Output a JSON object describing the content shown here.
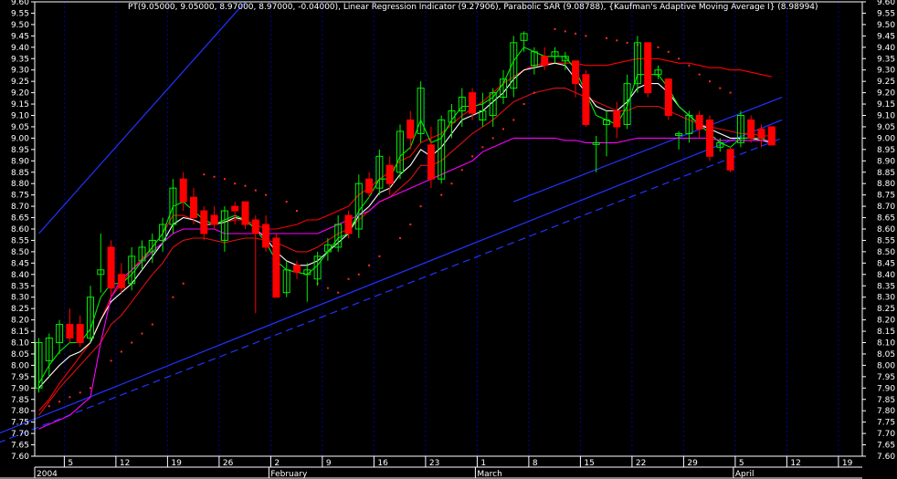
{
  "chart_data": {
    "type": "candlestick",
    "symbol": "PT",
    "header": "PT(9.05000, 9.05000, 8.97000, 8.97000, -0.04000), Linear Regression Indicator (9.27906), Parabolic SAR (9.08788), {Kaufman's Adaptive Moving Average I} (8.98994)",
    "ylim": [
      7.6,
      9.6
    ],
    "yticks": [
      "7.60",
      "7.65",
      "7.70",
      "7.75",
      "7.80",
      "7.85",
      "7.90",
      "7.95",
      "8.00",
      "8.05",
      "8.10",
      "8.15",
      "8.20",
      "8.25",
      "8.30",
      "8.35",
      "8.40",
      "8.45",
      "8.50",
      "8.55",
      "8.60",
      "8.65",
      "8.70",
      "8.75",
      "8.80",
      "8.85",
      "8.90",
      "8.95",
      "9.00",
      "9.05",
      "9.10",
      "9.15",
      "9.20",
      "9.25",
      "9.30",
      "9.35",
      "9.40",
      "9.45",
      "9.50",
      "9.55",
      "9.60"
    ],
    "xticks": [
      {
        "label": "5",
        "index": 3
      },
      {
        "label": "12",
        "index": 8
      },
      {
        "label": "19",
        "index": 13
      },
      {
        "label": "26",
        "index": 18
      },
      {
        "label": "2",
        "index": 23
      },
      {
        "label": "9",
        "index": 28
      },
      {
        "label": "16",
        "index": 33
      },
      {
        "label": "23",
        "index": 38
      },
      {
        "label": "1",
        "index": 43
      },
      {
        "label": "8",
        "index": 48
      },
      {
        "label": "15",
        "index": 53
      },
      {
        "label": "22",
        "index": 58
      },
      {
        "label": "29",
        "index": 63
      },
      {
        "label": "5",
        "index": 68
      },
      {
        "label": "12",
        "index": 73
      },
      {
        "label": "19",
        "index": 78
      }
    ],
    "months": [
      {
        "label": "2004",
        "index": 0
      },
      {
        "label": "February",
        "index": 23
      },
      {
        "label": "March",
        "index": 43
      },
      {
        "label": "April",
        "index": 68
      }
    ],
    "candles": [
      {
        "o": 7.9,
        "h": 8.12,
        "l": 7.88,
        "c": 8.1
      },
      {
        "o": 8.02,
        "h": 8.14,
        "l": 7.95,
        "c": 8.12
      },
      {
        "o": 8.1,
        "h": 8.2,
        "l": 8.05,
        "c": 8.18
      },
      {
        "o": 8.18,
        "h": 8.25,
        "l": 8.1,
        "c": 8.12
      },
      {
        "o": 8.18,
        "h": 8.22,
        "l": 8.08,
        "c": 8.1
      },
      {
        "o": 8.12,
        "h": 8.35,
        "l": 8.1,
        "c": 8.3
      },
      {
        "o": 8.4,
        "h": 8.58,
        "l": 8.32,
        "c": 8.42
      },
      {
        "o": 8.52,
        "h": 8.55,
        "l": 8.3,
        "c": 8.34
      },
      {
        "o": 8.4,
        "h": 8.45,
        "l": 8.32,
        "c": 8.34
      },
      {
        "o": 8.36,
        "h": 8.52,
        "l": 8.33,
        "c": 8.48
      },
      {
        "o": 8.46,
        "h": 8.55,
        "l": 8.42,
        "c": 8.52
      },
      {
        "o": 8.5,
        "h": 8.58,
        "l": 8.45,
        "c": 8.55
      },
      {
        "o": 8.55,
        "h": 8.65,
        "l": 8.5,
        "c": 8.62
      },
      {
        "o": 8.62,
        "h": 8.82,
        "l": 8.58,
        "c": 8.78
      },
      {
        "o": 8.82,
        "h": 8.85,
        "l": 8.68,
        "c": 8.72
      },
      {
        "o": 8.74,
        "h": 8.78,
        "l": 8.62,
        "c": 8.65
      },
      {
        "o": 8.68,
        "h": 8.7,
        "l": 8.55,
        "c": 8.58
      },
      {
        "o": 8.66,
        "h": 8.7,
        "l": 8.6,
        "c": 8.62
      },
      {
        "o": 8.55,
        "h": 8.7,
        "l": 8.5,
        "c": 8.68
      },
      {
        "o": 8.7,
        "h": 8.72,
        "l": 8.62,
        "c": 8.68
      },
      {
        "o": 8.72,
        "h": 8.72,
        "l": 8.6,
        "c": 8.62
      },
      {
        "o": 8.64,
        "h": 8.66,
        "l": 8.23,
        "c": 8.58
      },
      {
        "o": 8.62,
        "h": 8.66,
        "l": 8.5,
        "c": 8.52
      },
      {
        "o": 8.56,
        "h": 8.58,
        "l": 8.3,
        "c": 8.3
      },
      {
        "o": 8.32,
        "h": 8.46,
        "l": 8.3,
        "c": 8.42
      },
      {
        "o": 8.44,
        "h": 8.46,
        "l": 8.38,
        "c": 8.41
      },
      {
        "o": 8.4,
        "h": 8.45,
        "l": 8.28,
        "c": 8.42
      },
      {
        "o": 8.38,
        "h": 8.5,
        "l": 8.35,
        "c": 8.48
      },
      {
        "o": 8.5,
        "h": 8.56,
        "l": 8.46,
        "c": 8.53
      },
      {
        "o": 8.52,
        "h": 8.66,
        "l": 8.5,
        "c": 8.62
      },
      {
        "o": 8.66,
        "h": 8.68,
        "l": 8.56,
        "c": 8.58
      },
      {
        "o": 8.6,
        "h": 8.84,
        "l": 8.56,
        "c": 8.8
      },
      {
        "o": 8.82,
        "h": 8.85,
        "l": 8.74,
        "c": 8.76
      },
      {
        "o": 8.78,
        "h": 8.95,
        "l": 8.75,
        "c": 8.92
      },
      {
        "o": 8.88,
        "h": 8.92,
        "l": 8.75,
        "c": 8.8
      },
      {
        "o": 8.85,
        "h": 9.06,
        "l": 8.82,
        "c": 9.03
      },
      {
        "o": 9.08,
        "h": 9.12,
        "l": 8.95,
        "c": 9.0
      },
      {
        "o": 9.02,
        "h": 9.25,
        "l": 8.98,
        "c": 9.22
      },
      {
        "o": 8.97,
        "h": 9.05,
        "l": 8.78,
        "c": 8.82
      },
      {
        "o": 8.82,
        "h": 9.1,
        "l": 8.8,
        "c": 9.08
      },
      {
        "o": 9.07,
        "h": 9.15,
        "l": 9.0,
        "c": 9.12
      },
      {
        "o": 9.12,
        "h": 9.22,
        "l": 9.05,
        "c": 9.18
      },
      {
        "o": 9.2,
        "h": 9.22,
        "l": 9.08,
        "c": 9.11
      },
      {
        "o": 9.08,
        "h": 9.2,
        "l": 9.05,
        "c": 9.12
      },
      {
        "o": 9.1,
        "h": 9.22,
        "l": 9.05,
        "c": 9.2
      },
      {
        "o": 9.18,
        "h": 9.3,
        "l": 9.15,
        "c": 9.26
      },
      {
        "o": 9.22,
        "h": 9.45,
        "l": 9.18,
        "c": 9.42
      },
      {
        "o": 9.43,
        "h": 9.47,
        "l": 9.38,
        "c": 9.46
      },
      {
        "o": 9.32,
        "h": 9.4,
        "l": 9.28,
        "c": 9.38
      },
      {
        "o": 9.36,
        "h": 9.4,
        "l": 9.3,
        "c": 9.32
      },
      {
        "o": 9.36,
        "h": 9.4,
        "l": 9.33,
        "c": 9.38
      },
      {
        "o": 9.34,
        "h": 9.38,
        "l": 9.3,
        "c": 9.36
      },
      {
        "o": 9.34,
        "h": 9.34,
        "l": 9.18,
        "c": 9.24
      },
      {
        "o": 9.28,
        "h": 9.3,
        "l": 9.05,
        "c": 9.06
      },
      {
        "o": 8.98,
        "h": 9.01,
        "l": 8.85,
        "c": 8.98
      },
      {
        "o": 9.06,
        "h": 9.12,
        "l": 8.92,
        "c": 9.08
      },
      {
        "o": 9.12,
        "h": 9.16,
        "l": 9.0,
        "c": 9.05
      },
      {
        "o": 9.06,
        "h": 9.28,
        "l": 9.04,
        "c": 9.24
      },
      {
        "o": 9.24,
        "h": 9.45,
        "l": 9.2,
        "c": 9.42
      },
      {
        "o": 9.42,
        "h": 9.42,
        "l": 9.18,
        "c": 9.2
      },
      {
        "o": 9.28,
        "h": 9.32,
        "l": 9.26,
        "c": 9.3
      },
      {
        "o": 9.26,
        "h": 9.26,
        "l": 9.08,
        "c": 9.1
      },
      {
        "o": 9.02,
        "h": 9.03,
        "l": 8.95,
        "c": 9.02
      },
      {
        "o": 9.02,
        "h": 9.12,
        "l": 8.98,
        "c": 9.1
      },
      {
        "o": 9.1,
        "h": 9.12,
        "l": 9.0,
        "c": 9.04
      },
      {
        "o": 9.08,
        "h": 9.1,
        "l": 8.9,
        "c": 8.92
      },
      {
        "o": 8.96,
        "h": 9.0,
        "l": 8.94,
        "c": 8.98
      },
      {
        "o": 8.95,
        "h": 8.96,
        "l": 8.85,
        "c": 8.86
      },
      {
        "o": 8.98,
        "h": 9.12,
        "l": 8.96,
        "c": 9.1
      },
      {
        "o": 9.08,
        "h": 9.1,
        "l": 8.98,
        "c": 9.0
      },
      {
        "o": 9.04,
        "h": 9.06,
        "l": 8.96,
        "c": 9.0
      },
      {
        "o": 9.05,
        "h": 9.05,
        "l": 8.97,
        "c": 8.97
      }
    ],
    "series": [
      {
        "kind": "line",
        "color": "#ff0000",
        "values": [
          7.8,
          7.85,
          7.92,
          7.98,
          8.04,
          8.1,
          8.2,
          8.3,
          8.36,
          8.42,
          8.47,
          8.52,
          8.58,
          8.66,
          8.66,
          8.64,
          8.62,
          8.62,
          8.63,
          8.64,
          8.64,
          8.62,
          8.6,
          8.6,
          8.61,
          8.62,
          8.64,
          8.64,
          8.66,
          8.68,
          8.7,
          8.75,
          8.78,
          8.82,
          8.85,
          8.9,
          8.92,
          8.98,
          9.0,
          9.02,
          9.06,
          9.1,
          9.13,
          9.16,
          9.2,
          9.24,
          9.27,
          9.3,
          9.32,
          9.33,
          9.33,
          9.33,
          9.33,
          9.32,
          9.32,
          9.32,
          9.33,
          9.34,
          9.35,
          9.35,
          9.35,
          9.34,
          9.33,
          9.33,
          9.32,
          9.31,
          9.31,
          9.3,
          9.3,
          9.29,
          9.28,
          9.27
        ]
      },
      {
        "kind": "line",
        "color": "#dd1111",
        "values": [
          7.78,
          7.84,
          7.9,
          7.95,
          8.0,
          8.05,
          8.1,
          8.18,
          8.22,
          8.28,
          8.34,
          8.4,
          8.45,
          8.52,
          8.55,
          8.56,
          8.56,
          8.55,
          8.54,
          8.55,
          8.56,
          8.56,
          8.55,
          8.54,
          8.52,
          8.5,
          8.5,
          8.52,
          8.55,
          8.58,
          8.6,
          8.64,
          8.68,
          8.72,
          8.74,
          8.78,
          8.82,
          8.88,
          8.88,
          8.9,
          8.94,
          8.98,
          9.02,
          9.05,
          9.08,
          9.12,
          9.16,
          9.18,
          9.2,
          9.21,
          9.22,
          9.22,
          9.2,
          9.18,
          9.16,
          9.14,
          9.12,
          9.12,
          9.14,
          9.14,
          9.14,
          9.12,
          9.1,
          9.08,
          9.06,
          9.05,
          9.04,
          9.03,
          9.02,
          9.02,
          9.01,
          9.01
        ]
      },
      {
        "kind": "line",
        "color": "#ffffff",
        "values": [
          7.9,
          7.95,
          8.0,
          8.04,
          8.06,
          8.1,
          8.2,
          8.28,
          8.32,
          8.36,
          8.42,
          8.48,
          8.54,
          8.62,
          8.65,
          8.64,
          8.62,
          8.62,
          8.63,
          8.65,
          8.64,
          8.6,
          8.56,
          8.5,
          8.46,
          8.44,
          8.44,
          8.46,
          8.5,
          8.54,
          8.58,
          8.66,
          8.7,
          8.76,
          8.78,
          8.84,
          8.88,
          8.95,
          8.92,
          8.96,
          9.02,
          9.08,
          9.1,
          9.12,
          9.16,
          9.2,
          9.26,
          9.3,
          9.31,
          9.32,
          9.33,
          9.32,
          9.26,
          9.2,
          9.14,
          9.12,
          9.12,
          9.16,
          9.22,
          9.24,
          9.24,
          9.2,
          9.14,
          9.1,
          9.06,
          9.04,
          9.02,
          9.0,
          9.0,
          9.0,
          8.99,
          8.98
        ]
      },
      {
        "kind": "line",
        "color": "#00ee00",
        "values": [
          7.92,
          8.0,
          8.06,
          8.1,
          8.1,
          8.16,
          8.3,
          8.36,
          8.36,
          8.4,
          8.46,
          8.52,
          8.58,
          8.7,
          8.72,
          8.68,
          8.64,
          8.62,
          8.64,
          8.66,
          8.64,
          8.6,
          8.54,
          8.46,
          8.42,
          8.41,
          8.4,
          8.44,
          8.5,
          8.56,
          8.58,
          8.68,
          8.74,
          8.82,
          8.82,
          8.92,
          8.96,
          9.08,
          8.98,
          9.0,
          9.08,
          9.14,
          9.14,
          9.15,
          9.18,
          9.24,
          9.34,
          9.4,
          9.38,
          9.36,
          9.36,
          9.36,
          9.3,
          9.2,
          9.1,
          9.08,
          9.06,
          9.14,
          9.28,
          9.28,
          9.28,
          9.22,
          9.14,
          9.1,
          9.06,
          9.02,
          8.98,
          8.96,
          9.0,
          9.0,
          9.0,
          8.98
        ]
      },
      {
        "kind": "line",
        "color": "#ff00ff",
        "values": [
          7.72,
          7.74,
          7.76,
          7.78,
          7.82,
          7.86,
          8.1,
          8.3,
          8.38,
          8.42,
          8.46,
          8.5,
          8.54,
          8.58,
          8.6,
          8.6,
          8.6,
          8.6,
          8.58,
          8.58,
          8.58,
          8.58,
          8.58,
          8.58,
          8.58,
          8.58,
          8.58,
          8.58,
          8.6,
          8.62,
          8.64,
          8.66,
          8.68,
          8.72,
          8.74,
          8.76,
          8.78,
          8.8,
          8.82,
          8.84,
          8.86,
          8.88,
          8.9,
          8.94,
          8.96,
          8.98,
          9.0,
          9.0,
          9.0,
          9.0,
          9.0,
          8.99,
          8.99,
          8.98,
          8.98,
          8.98,
          8.98,
          8.99,
          9.0,
          9.0,
          9.0,
          9.0,
          9.0,
          9.0,
          9.0,
          9.0,
          8.99,
          8.99,
          8.99,
          8.99,
          8.99,
          8.99
        ]
      }
    ],
    "sar": [
      {
        "i": 1,
        "v": 7.82
      },
      {
        "i": 2,
        "v": 7.84
      },
      {
        "i": 3,
        "v": 7.86
      },
      {
        "i": 4,
        "v": 7.88
      },
      {
        "i": 5,
        "v": 7.9
      },
      {
        "i": 7,
        "v": 8.02
      },
      {
        "i": 8,
        "v": 8.06
      },
      {
        "i": 9,
        "v": 8.1
      },
      {
        "i": 10,
        "v": 8.14
      },
      {
        "i": 11,
        "v": 8.18
      },
      {
        "i": 13,
        "v": 8.3
      },
      {
        "i": 14,
        "v": 8.36
      },
      {
        "i": 16,
        "v": 8.84
      },
      {
        "i": 17,
        "v": 8.83
      },
      {
        "i": 18,
        "v": 8.82
      },
      {
        "i": 19,
        "v": 8.8
      },
      {
        "i": 20,
        "v": 8.79
      },
      {
        "i": 21,
        "v": 8.77
      },
      {
        "i": 22,
        "v": 8.75
      },
      {
        "i": 24,
        "v": 8.72
      },
      {
        "i": 25,
        "v": 8.68
      },
      {
        "i": 26,
        "v": 8.4
      },
      {
        "i": 27,
        "v": 8.36
      },
      {
        "i": 28,
        "v": 8.34
      },
      {
        "i": 29,
        "v": 8.32
      },
      {
        "i": 30,
        "v": 8.38
      },
      {
        "i": 31,
        "v": 8.4
      },
      {
        "i": 32,
        "v": 8.44
      },
      {
        "i": 33,
        "v": 8.48
      },
      {
        "i": 35,
        "v": 8.56
      },
      {
        "i": 36,
        "v": 8.62
      },
      {
        "i": 37,
        "v": 8.7
      },
      {
        "i": 39,
        "v": 8.75
      },
      {
        "i": 40,
        "v": 8.8
      },
      {
        "i": 41,
        "v": 8.86
      },
      {
        "i": 42,
        "v": 8.92
      },
      {
        "i": 43,
        "v": 8.96
      },
      {
        "i": 44,
        "v": 9.0
      },
      {
        "i": 45,
        "v": 9.04
      },
      {
        "i": 46,
        "v": 9.08
      },
      {
        "i": 47,
        "v": 9.15
      },
      {
        "i": 48,
        "v": 9.2
      },
      {
        "i": 50,
        "v": 9.48
      },
      {
        "i": 51,
        "v": 9.47
      },
      {
        "i": 52,
        "v": 9.46
      },
      {
        "i": 53,
        "v": 9.45
      },
      {
        "i": 55,
        "v": 9.44
      },
      {
        "i": 56,
        "v": 9.43
      },
      {
        "i": 57,
        "v": 9.42
      },
      {
        "i": 58,
        "v": 9.41
      },
      {
        "i": 60,
        "v": 9.4
      },
      {
        "i": 61,
        "v": 9.38
      },
      {
        "i": 62,
        "v": 9.35
      },
      {
        "i": 63,
        "v": 9.32
      },
      {
        "i": 64,
        "v": 9.28
      },
      {
        "i": 65,
        "v": 9.25
      },
      {
        "i": 66,
        "v": 9.22
      },
      {
        "i": 67,
        "v": 9.2
      }
    ],
    "channels": [
      {
        "color": "#2233ff",
        "dash": false,
        "from": [
          0,
          8.58
        ],
        "to": [
          20,
          9.6
        ]
      },
      {
        "color": "#2233ff",
        "dash": false,
        "from": [
          -5,
          7.68
        ],
        "to": [
          72,
          9.08
        ]
      },
      {
        "color": "#2233ff",
        "dash": false,
        "from": [
          46,
          8.72
        ],
        "to": [
          72,
          9.18
        ]
      },
      {
        "color": "#2233ff",
        "dash": true,
        "from": [
          -5,
          7.64
        ],
        "to": [
          72,
          9.0
        ]
      }
    ],
    "grid": true,
    "colors": {
      "up": "#00ee00",
      "down": "#ff0000",
      "background": "#000000",
      "axis": "#ffffff",
      "grid": "#0000aa"
    }
  }
}
